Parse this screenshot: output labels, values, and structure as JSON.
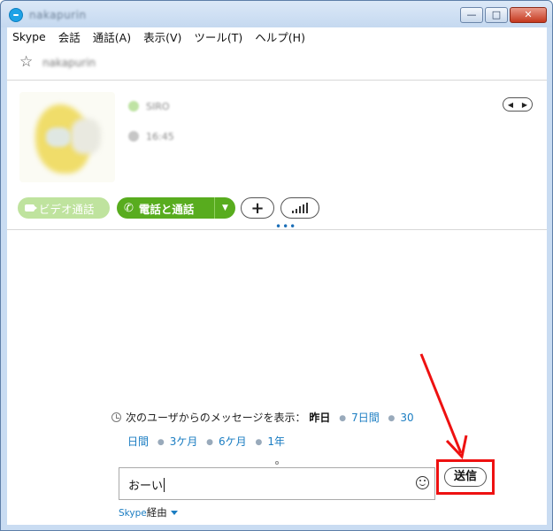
{
  "window": {
    "title": "nakapurin",
    "minimize": "—",
    "maximize": "□",
    "close": "✕"
  },
  "menu": [
    "Skype",
    "会話",
    "通話(A)",
    "表示(V)",
    "ツール(T)",
    "ヘルプ(H)"
  ],
  "contact": {
    "name": "nakapurin",
    "phone_status": "SIRO",
    "time": "16:45"
  },
  "actions": {
    "video": "ビデオ通話",
    "call": "電話と通話",
    "add": "+"
  },
  "history": {
    "label": "次のユーザからのメッセージを表示：",
    "selected": "昨日",
    "link_7d": "7日間",
    "link_30d_a": "30",
    "link_30d_b": "日間",
    "link_3m": "3ケ月",
    "link_6m": "6ケ月",
    "link_1y": "1年"
  },
  "message": {
    "value": "おーい"
  },
  "send_label": "送信",
  "via": {
    "link": "Skype",
    "rest": "経由"
  },
  "colors": {
    "green": "#58ac1e",
    "link": "#1b7dc2",
    "highlight": "#ee1111"
  }
}
